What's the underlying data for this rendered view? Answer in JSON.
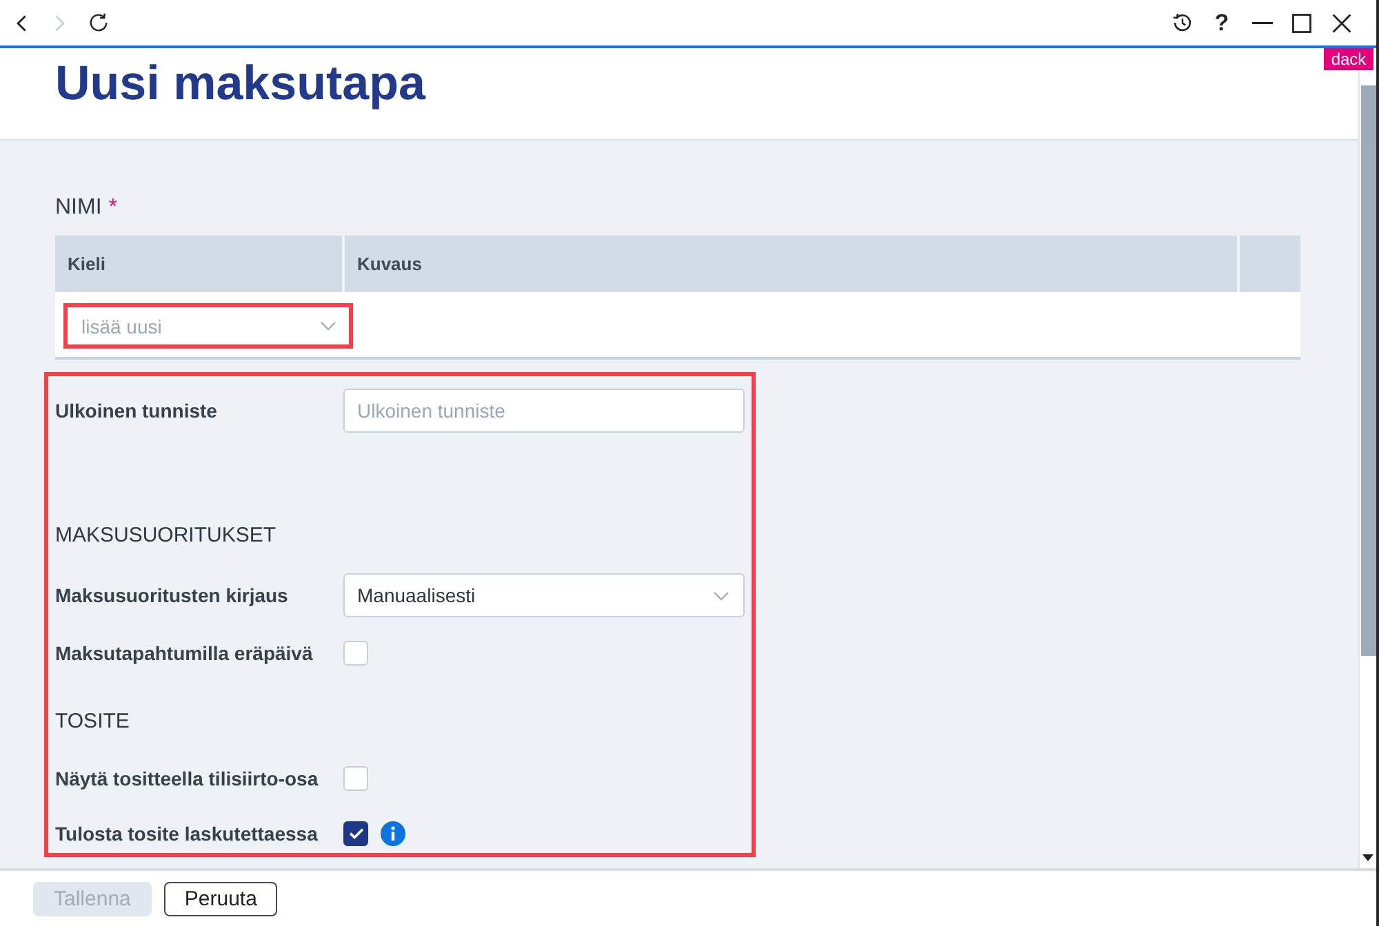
{
  "toolbar": {
    "nav_buttons": [
      {
        "kind": "back",
        "disabled": false
      },
      {
        "kind": "forward",
        "disabled": true
      },
      {
        "kind": "reload",
        "disabled": false
      }
    ],
    "help_label": "?"
  },
  "env_badge": "dack",
  "page_title": "Uusi maksutapa",
  "name_section": {
    "label": "NIMI",
    "required_mark": "*",
    "columns": [
      "Kieli",
      "Kuvaus"
    ],
    "add_select": {
      "placeholder": "lisää uusi",
      "highlighted": true
    }
  },
  "form": {
    "highlighted": true,
    "items": [
      {
        "kind": "text",
        "label": "Ulkoinen tunniste",
        "placeholder": "Ulkoinen tunniste"
      },
      {
        "kind": "heading",
        "label": "MAKSUSUORITUKSET"
      },
      {
        "kind": "select",
        "label": "Maksusuoritusten kirjaus",
        "value": "Manuaalisesti"
      },
      {
        "kind": "checkbox",
        "label": "Maksutapahtumilla eräpäivä",
        "checked": false
      },
      {
        "kind": "heading",
        "label": "TOSITE"
      },
      {
        "kind": "checkbox",
        "label": "Näytä tositteella tilisiirto-osa",
        "checked": false
      },
      {
        "kind": "checkbox",
        "label": "Tulosta tosite laskutettaessa",
        "checked": true,
        "info": true
      }
    ]
  },
  "footer_buttons": [
    {
      "kind": "primary",
      "label": "Tallenna",
      "disabled": true
    },
    {
      "kind": "secondary",
      "label": "Peruuta",
      "disabled": false
    }
  ]
}
